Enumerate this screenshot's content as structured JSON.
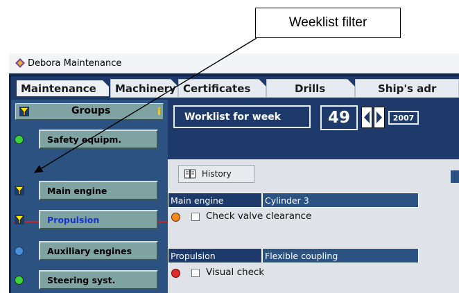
{
  "callout": {
    "text": "Weeklist filter"
  },
  "window": {
    "title": "Debora Maintenance"
  },
  "tabs": [
    "Maintenance",
    "Machinery",
    "Certificates",
    "Drills",
    "Ship's adr"
  ],
  "groups": {
    "header": "Groups",
    "info": "i",
    "items": [
      {
        "label": "Safety equipm.",
        "indicator": "green-dot",
        "color": "#000000"
      },
      {
        "label": "Main engine",
        "indicator": "filter-icon",
        "color": "#000000"
      },
      {
        "label": "Propulsion",
        "indicator": "filter-icon",
        "color": "#1a33cc"
      },
      {
        "label": "Auxiliary engines",
        "indicator": "blue-dot",
        "color": "#000000"
      },
      {
        "label": "Steering syst.",
        "indicator": "green-dot",
        "color": "#000000"
      }
    ]
  },
  "worklist": {
    "label": "Worklist for week",
    "week": "49",
    "year": "2007"
  },
  "history_button": "History",
  "tasks": [
    {
      "group": "Main engine",
      "component": "Cylinder 3",
      "task": "Check valve clearance",
      "status_color": "#f08a1c"
    },
    {
      "group": "Propulsion",
      "component": "Flexible coupling",
      "task": "Visual check",
      "status_color": "#e02a2a"
    }
  ],
  "colors": {
    "navy": "#1d3a6b",
    "panel_blue": "#2c5281",
    "teal_button": "#7fa3a3",
    "red_separator": "#d12222"
  }
}
